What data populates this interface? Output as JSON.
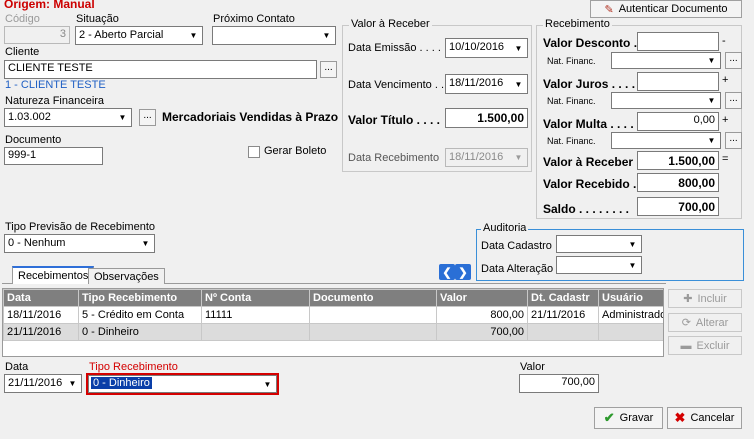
{
  "origin_label": "Origem: Manual",
  "authenticate_button": "Autenticar Documento",
  "codigo": {
    "label": "Código",
    "value": "3"
  },
  "situacao": {
    "label": "Situação",
    "value": "2 - Aberto Parcial"
  },
  "proximo_contato": {
    "label": "Próximo Contato",
    "value": ""
  },
  "cliente": {
    "label": "Cliente",
    "value": "CLIENTE TESTE",
    "sublabel": "1 - CLIENTE TESTE"
  },
  "natureza": {
    "label": "Natureza Financeira",
    "value": "1.03.002",
    "description": "Mercadoriais Vendidas à Prazo"
  },
  "documento": {
    "label": "Documento",
    "value": "999-1"
  },
  "gerar_boleto": {
    "label": "Gerar Boleto",
    "checked": false
  },
  "valor_receber_group": {
    "title": "Valor à Receber",
    "data_emissao_label": "Data Emissão . . . .",
    "data_emissao": "10/10/2016",
    "data_vencimento_label": "Data Vencimento . .",
    "data_vencimento": "18/11/2016",
    "valor_titulo_label": "Valor Título . . . .",
    "valor_titulo": "1.500,00",
    "data_recebimento_label": "Data Recebimento",
    "data_recebimento": "18/11/2016"
  },
  "recebimento_group": {
    "title": "Recebimento",
    "valor_desconto_label": "Valor Desconto .",
    "valor_desconto": "",
    "minus_sign": "-",
    "nat_financ_label": "Nat. Financ.",
    "valor_juros_label": "Valor Juros . . . .",
    "valor_juros": "",
    "plus_sign": "+",
    "valor_multa_label": "Valor Multa . . . .",
    "valor_multa": "0,00",
    "valor_receber_label": "Valor à Receber",
    "valor_receber": "1.500,00",
    "equals_sign": "=",
    "valor_recebido_label": "Valor Recebido .",
    "valor_recebido": "800,00",
    "saldo_label": "Saldo . . . . . . . .",
    "saldo": "700,00"
  },
  "tipo_previsao": {
    "label": "Tipo Previsão de Recebimento",
    "value": "0 - Nenhum"
  },
  "auditoria": {
    "title": "Auditoria",
    "data_cadastro_label": "Data Cadastro .",
    "data_alteracao_label": "Data Alteração ."
  },
  "tabs": [
    "Recebimentos",
    "Observações"
  ],
  "table": {
    "headers": [
      "Data",
      "Tipo Recebimento",
      "Nº Conta",
      "Documento",
      "Valor",
      "Dt. Cadastr",
      "Usuário"
    ],
    "rows": [
      [
        "18/11/2016",
        "5 - Crédito em Conta",
        "11111",
        "",
        "800,00",
        "21/11/2016",
        "Administrador"
      ],
      [
        "21/11/2016",
        "0 - Dinheiro",
        "",
        "",
        "700,00",
        "",
        ""
      ]
    ]
  },
  "side_buttons": {
    "incluir": "Incluir",
    "alterar": "Alterar",
    "excluir": "Excluir"
  },
  "edit_row": {
    "data_label": "Data",
    "data_value": "21/11/2016",
    "tipo_label": "Tipo Recebimento",
    "tipo_value": "0 - Dinheiro",
    "valor_label": "Valor",
    "valor_value": "700,00"
  },
  "actions": {
    "gravar": "Gravar",
    "cancelar": "Cancelar"
  },
  "colors": {
    "origin_red": "#cc0000",
    "client_blue": "#1f5fc4",
    "header_gray": "#7f7f7f",
    "focus_red": "#d40000",
    "selection_blue": "#0a3ea8"
  }
}
